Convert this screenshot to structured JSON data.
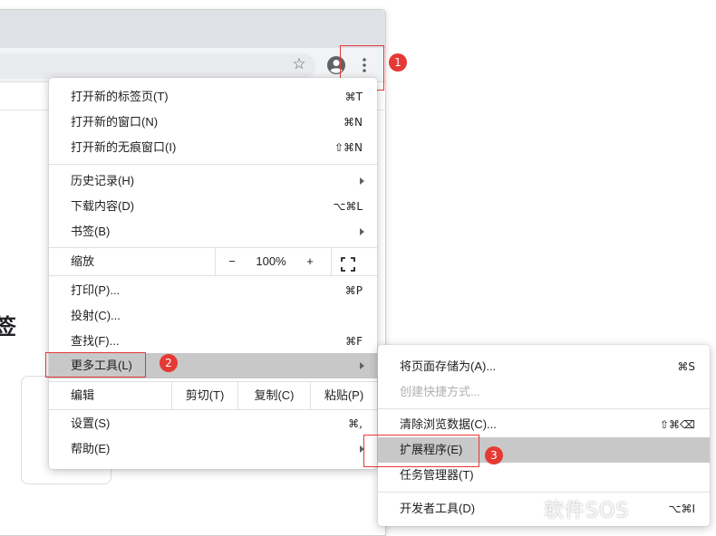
{
  "browser": {
    "partial_heading": "签"
  },
  "annotations": {
    "badge1": "1",
    "badge2": "2",
    "badge3": "3"
  },
  "icons": {
    "star": "star-icon",
    "avatar": "avatar-icon",
    "menu": "kebab-icon",
    "fullscreen": "fullscreen-icon"
  },
  "menu": {
    "new_tab": {
      "label": "打开新的标签页(T)",
      "shortcut": "⌘T"
    },
    "new_window": {
      "label": "打开新的窗口(N)",
      "shortcut": "⌘N"
    },
    "new_incognito": {
      "label": "打开新的无痕窗口(I)",
      "shortcut": "⇧⌘N"
    },
    "history": {
      "label": "历史记录(H)"
    },
    "downloads": {
      "label": "下载内容(D)",
      "shortcut": "⌥⌘L"
    },
    "bookmarks": {
      "label": "书签(B)"
    },
    "zoom": {
      "label": "缩放",
      "minus": "−",
      "value": "100%",
      "plus": "+"
    },
    "print": {
      "label": "打印(P)...",
      "shortcut": "⌘P"
    },
    "cast": {
      "label": "投射(C)..."
    },
    "find": {
      "label": "查找(F)...",
      "shortcut": "⌘F"
    },
    "more_tools": {
      "label": "更多工具(L)"
    },
    "edit": {
      "label": "编辑",
      "cut": "剪切(T)",
      "copy": "复制(C)",
      "paste": "粘贴(P)"
    },
    "settings": {
      "label": "设置(S)",
      "shortcut": "⌘,"
    },
    "help": {
      "label": "帮助(E)"
    }
  },
  "submenu": {
    "save_page": {
      "label": "将页面存储为(A)...",
      "shortcut": "⌘S"
    },
    "create_shortcut": {
      "label": "创建快捷方式..."
    },
    "clear_data": {
      "label": "清除浏览数据(C)...",
      "shortcut": "⇧⌘⌫"
    },
    "extensions": {
      "label": "扩展程序(E)"
    },
    "task_manager": {
      "label": "任务管理器(T)"
    },
    "dev_tools": {
      "label": "开发者工具(D)",
      "shortcut": "⌥⌘I"
    }
  },
  "watermark": "软件SOS",
  "colors": {
    "annotation_red": "#e53935",
    "highlight": "#c8c8c8"
  }
}
